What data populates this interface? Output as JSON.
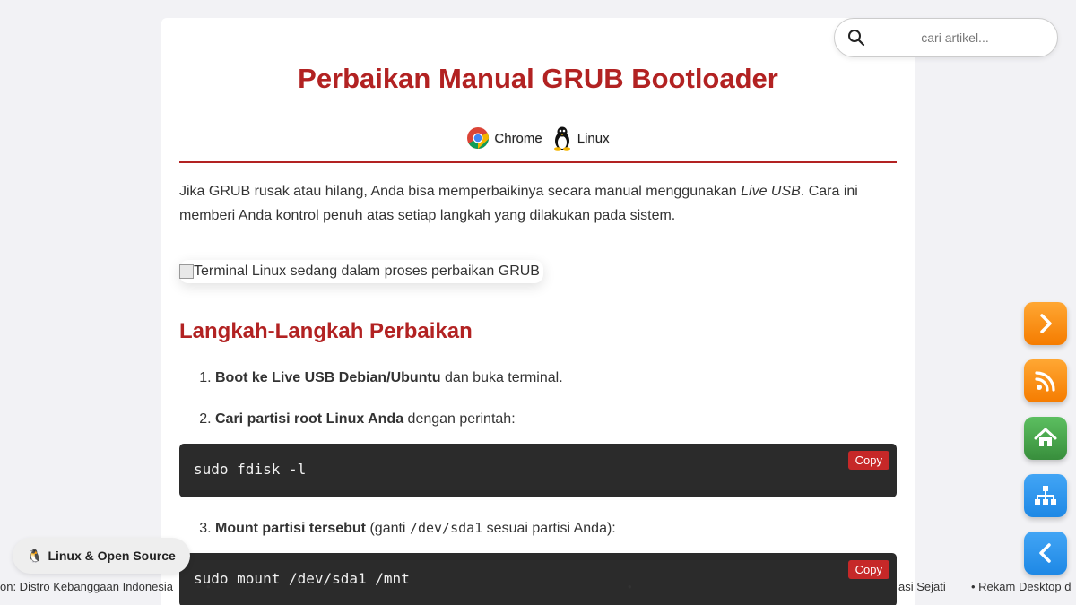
{
  "article": {
    "title": "Perbaikan Manual GRUB Bootloader",
    "tags": [
      "Chrome",
      "Linux"
    ],
    "intro_part1": "Jika GRUB rusak atau hilang, Anda bisa memperbaikinya secara manual menggunakan ",
    "intro_em": "Live USB",
    "intro_part2": ". Cara ini memberi Anda kontrol penuh atas setiap langkah yang dilakukan pada sistem.",
    "image_alt": "Terminal Linux sedang dalam proses perbaikan GRUB",
    "section_heading": "Langkah-Langkah Perbaikan",
    "steps": [
      {
        "bold": "Boot ke Live USB Debian/Ubuntu",
        "rest": " dan buka terminal."
      },
      {
        "bold": "Cari partisi root Linux Anda",
        "rest": " dengan perintah:",
        "code": "sudo fdisk -l"
      },
      {
        "bold": "Mount partisi tersebut",
        "rest_before": " (ganti ",
        "inline_code": "/dev/sda1",
        "rest_after": " sesuai partisi Anda):",
        "code": "sudo mount /dev/sda1 /mnt"
      }
    ],
    "copy_label": "Copy"
  },
  "search": {
    "placeholder": "cari artikel..."
  },
  "badge": {
    "emoji": "🐧",
    "label": "Linux & Open Source"
  },
  "ticker": {
    "items": [
      "on: Distro Kebanggaan Indonesia",
      "•",
      "•",
      "asi Sejati",
      "•  Rekam Desktop d"
    ]
  },
  "side_buttons": [
    {
      "name": "next-icon",
      "color": "#f7931e"
    },
    {
      "name": "rss-icon",
      "color": "#f7931e"
    },
    {
      "name": "home-icon",
      "color": "#4caf50"
    },
    {
      "name": "sitemap-icon",
      "color": "#2196f3"
    },
    {
      "name": "back-icon",
      "color": "#2196f3"
    }
  ],
  "colors": {
    "accent": "#b22222",
    "code_bg": "#2b2b2b",
    "copy_btn": "#c62828"
  }
}
